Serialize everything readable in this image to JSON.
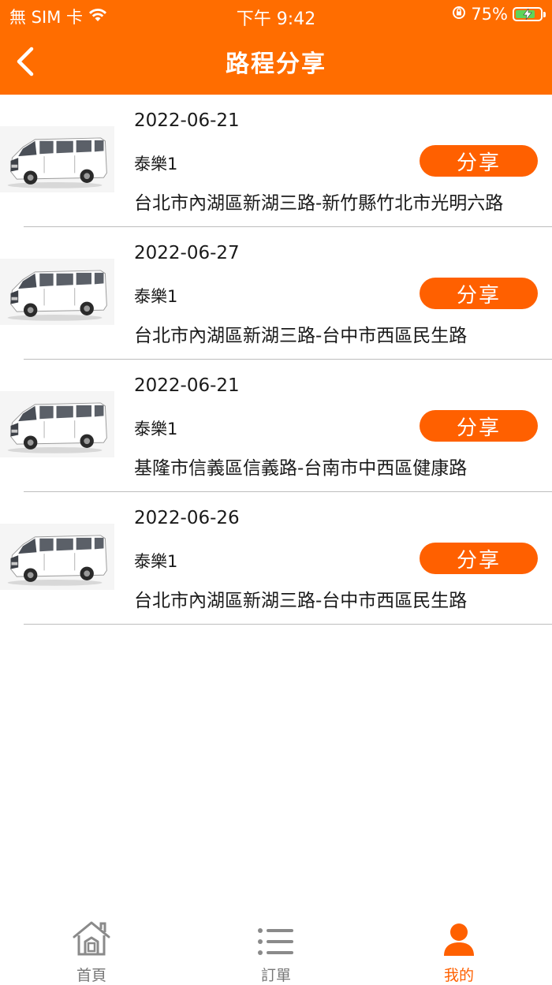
{
  "status_bar": {
    "carrier": "無 SIM 卡",
    "time": "下午 9:42",
    "battery_percent": "75%"
  },
  "header": {
    "title": "路程分享"
  },
  "trips": [
    {
      "date": "2022-06-21",
      "company": "泰樂1",
      "route": "台北市內湖區新湖三路-新竹縣竹北市光明六路",
      "share_label": "分享"
    },
    {
      "date": "2022-06-27",
      "company": "泰樂1",
      "route": "台北市內湖區新湖三路-台中市西區民生路",
      "share_label": "分享"
    },
    {
      "date": "2022-06-21",
      "company": "泰樂1",
      "route": "基隆市信義區信義路-台南市中西區健康路",
      "share_label": "分享"
    },
    {
      "date": "2022-06-26",
      "company": "泰樂1",
      "route": "台北市內湖區新湖三路-台中市西區民生路",
      "share_label": "分享"
    }
  ],
  "tabbar": {
    "home": "首頁",
    "orders": "訂單",
    "mine": "我的"
  },
  "colors": {
    "brand": "#ff6d00",
    "button": "#ff6000"
  }
}
